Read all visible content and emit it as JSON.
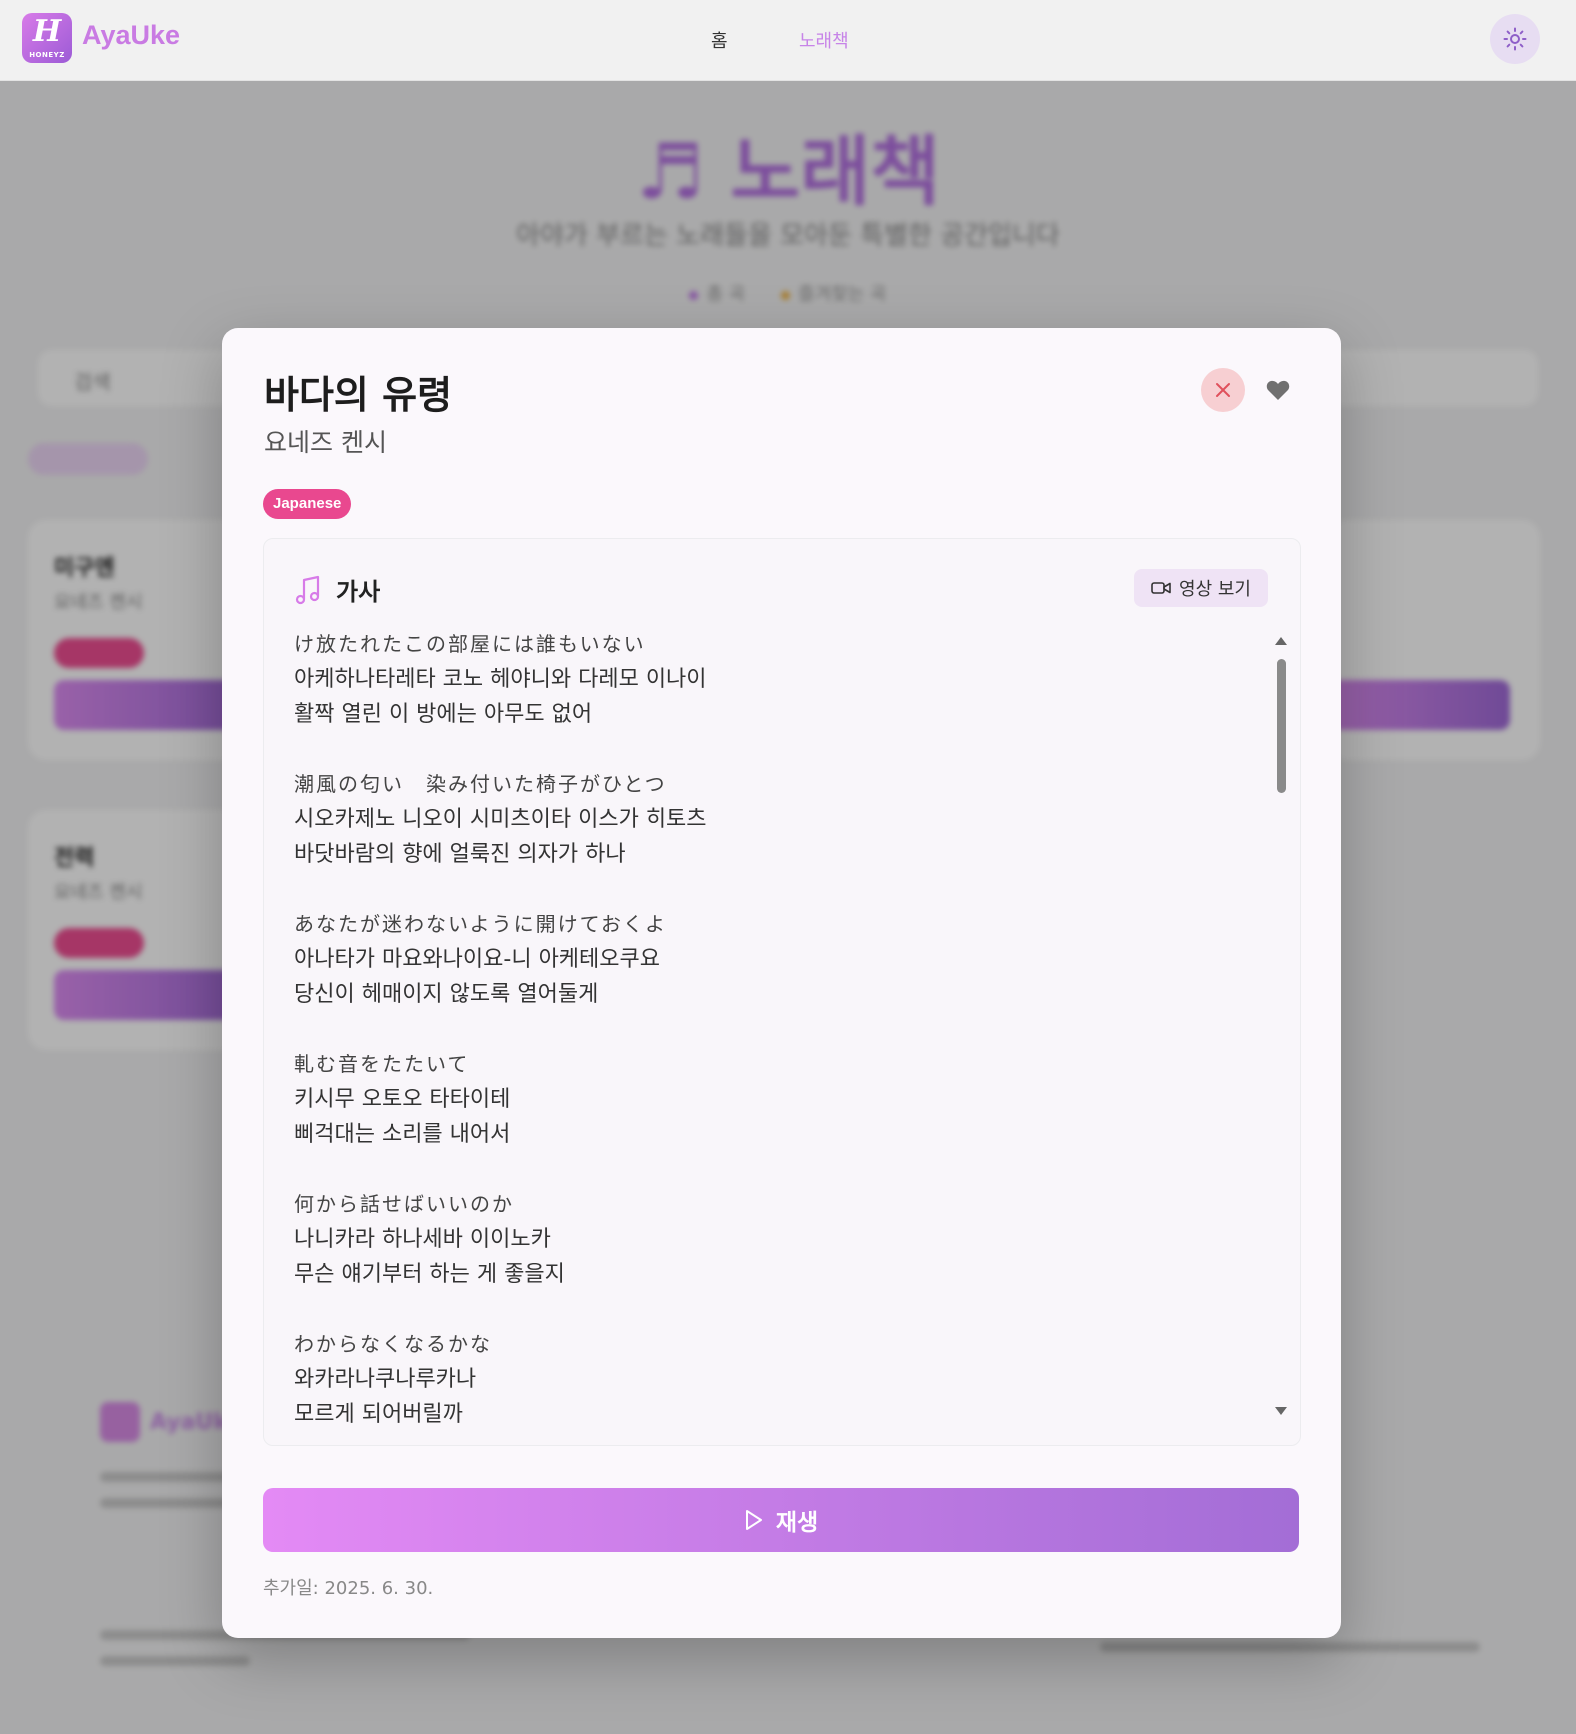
{
  "app": {
    "brand": "AyaUke",
    "logo_mark": "H",
    "logo_sub": "HONEYZ"
  },
  "nav": {
    "home": "홈",
    "songbook": "노래책"
  },
  "icons": {
    "theme": "sun-icon",
    "close": "close-icon",
    "favorite": "heart-icon",
    "lyrics": "music-note-icon",
    "video": "video-camera-icon",
    "play": "play-icon"
  },
  "colors": {
    "accent": "#c97be3",
    "tag": "#e9488f",
    "close_bg": "#f7cfd2",
    "close_icon": "#e0505c"
  },
  "modal": {
    "title": "바다의 유령",
    "artist": "요네즈 켄시",
    "tag": "Japanese",
    "lyrics_heading": "가사",
    "video_button": "영상 보기",
    "lyrics": [
      "け放たれたこの部屋には誰もいない",
      "아케하나타레타 코노 헤야니와 다레모 이나이",
      "활짝 열린 이 방에는 아무도 없어",
      "",
      "潮風の匂い　染み付いた椅子がひとつ",
      "시오카제노 니오이 시미츠이타 이스가 히토츠",
      "바닷바람의 향에 얼룩진 의자가 하나",
      "",
      "あなたが迷わないように開けておくよ",
      "아나타가 마요와나이요-니 아케테오쿠요",
      "당신이 헤매이지 않도록 열어둘게",
      "",
      "軋む音をたたいて",
      "키시무 오토오 타타이테",
      "삐걱대는 소리를 내어서",
      "",
      "何から話せばいいのか",
      "나니카라 하나세바 이이노카",
      "무슨 얘기부터 하는 게 좋을지",
      "",
      "わからなくなるかな",
      "와카라나쿠나루카나",
      "모르게 되어버릴까"
    ],
    "play_label": "재생",
    "added_date": "추가일: 2025. 6. 30."
  },
  "background": {
    "title": "♬ 노래책",
    "subtitle": "아야가 부르는 노래들을 모아둔 특별한 공간입니다",
    "stats_a": "총 곡",
    "stats_b": "즐겨찾는 곡",
    "search_placeholder": "검색",
    "card1_title": "미구엔",
    "card1_artist": "요네즈 켄시",
    "card2_title": "전력",
    "card2_artist": "요네즈 켄시",
    "footer_name": "AyaUke"
  }
}
